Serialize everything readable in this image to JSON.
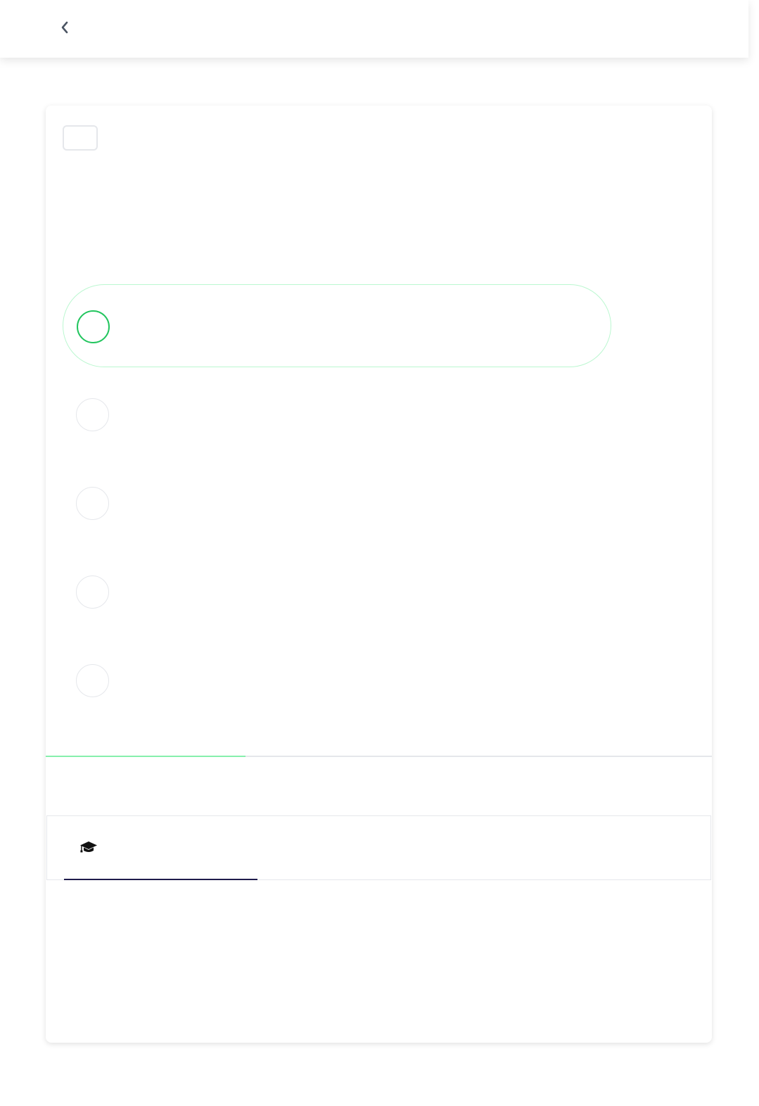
{
  "header": {
    "back_icon": "chevron-left-icon"
  },
  "question": {
    "badge_label": "",
    "text": ""
  },
  "options": [
    {
      "label": "",
      "selected": true
    },
    {
      "label": "",
      "selected": false
    },
    {
      "label": "",
      "selected": false
    },
    {
      "label": "",
      "selected": false
    },
    {
      "label": "",
      "selected": false
    }
  ],
  "progress": {
    "fraction": 0.3
  },
  "tabs": [
    {
      "icon": "graduation-cap-icon",
      "label": "",
      "active": true
    }
  ],
  "tab_content": {
    "text": ""
  },
  "colors": {
    "accent_green": "#22c55e",
    "selected_border": "#bbf7d0",
    "progress_fill": "#86efac",
    "tab_underline": "#1e1b4b"
  }
}
